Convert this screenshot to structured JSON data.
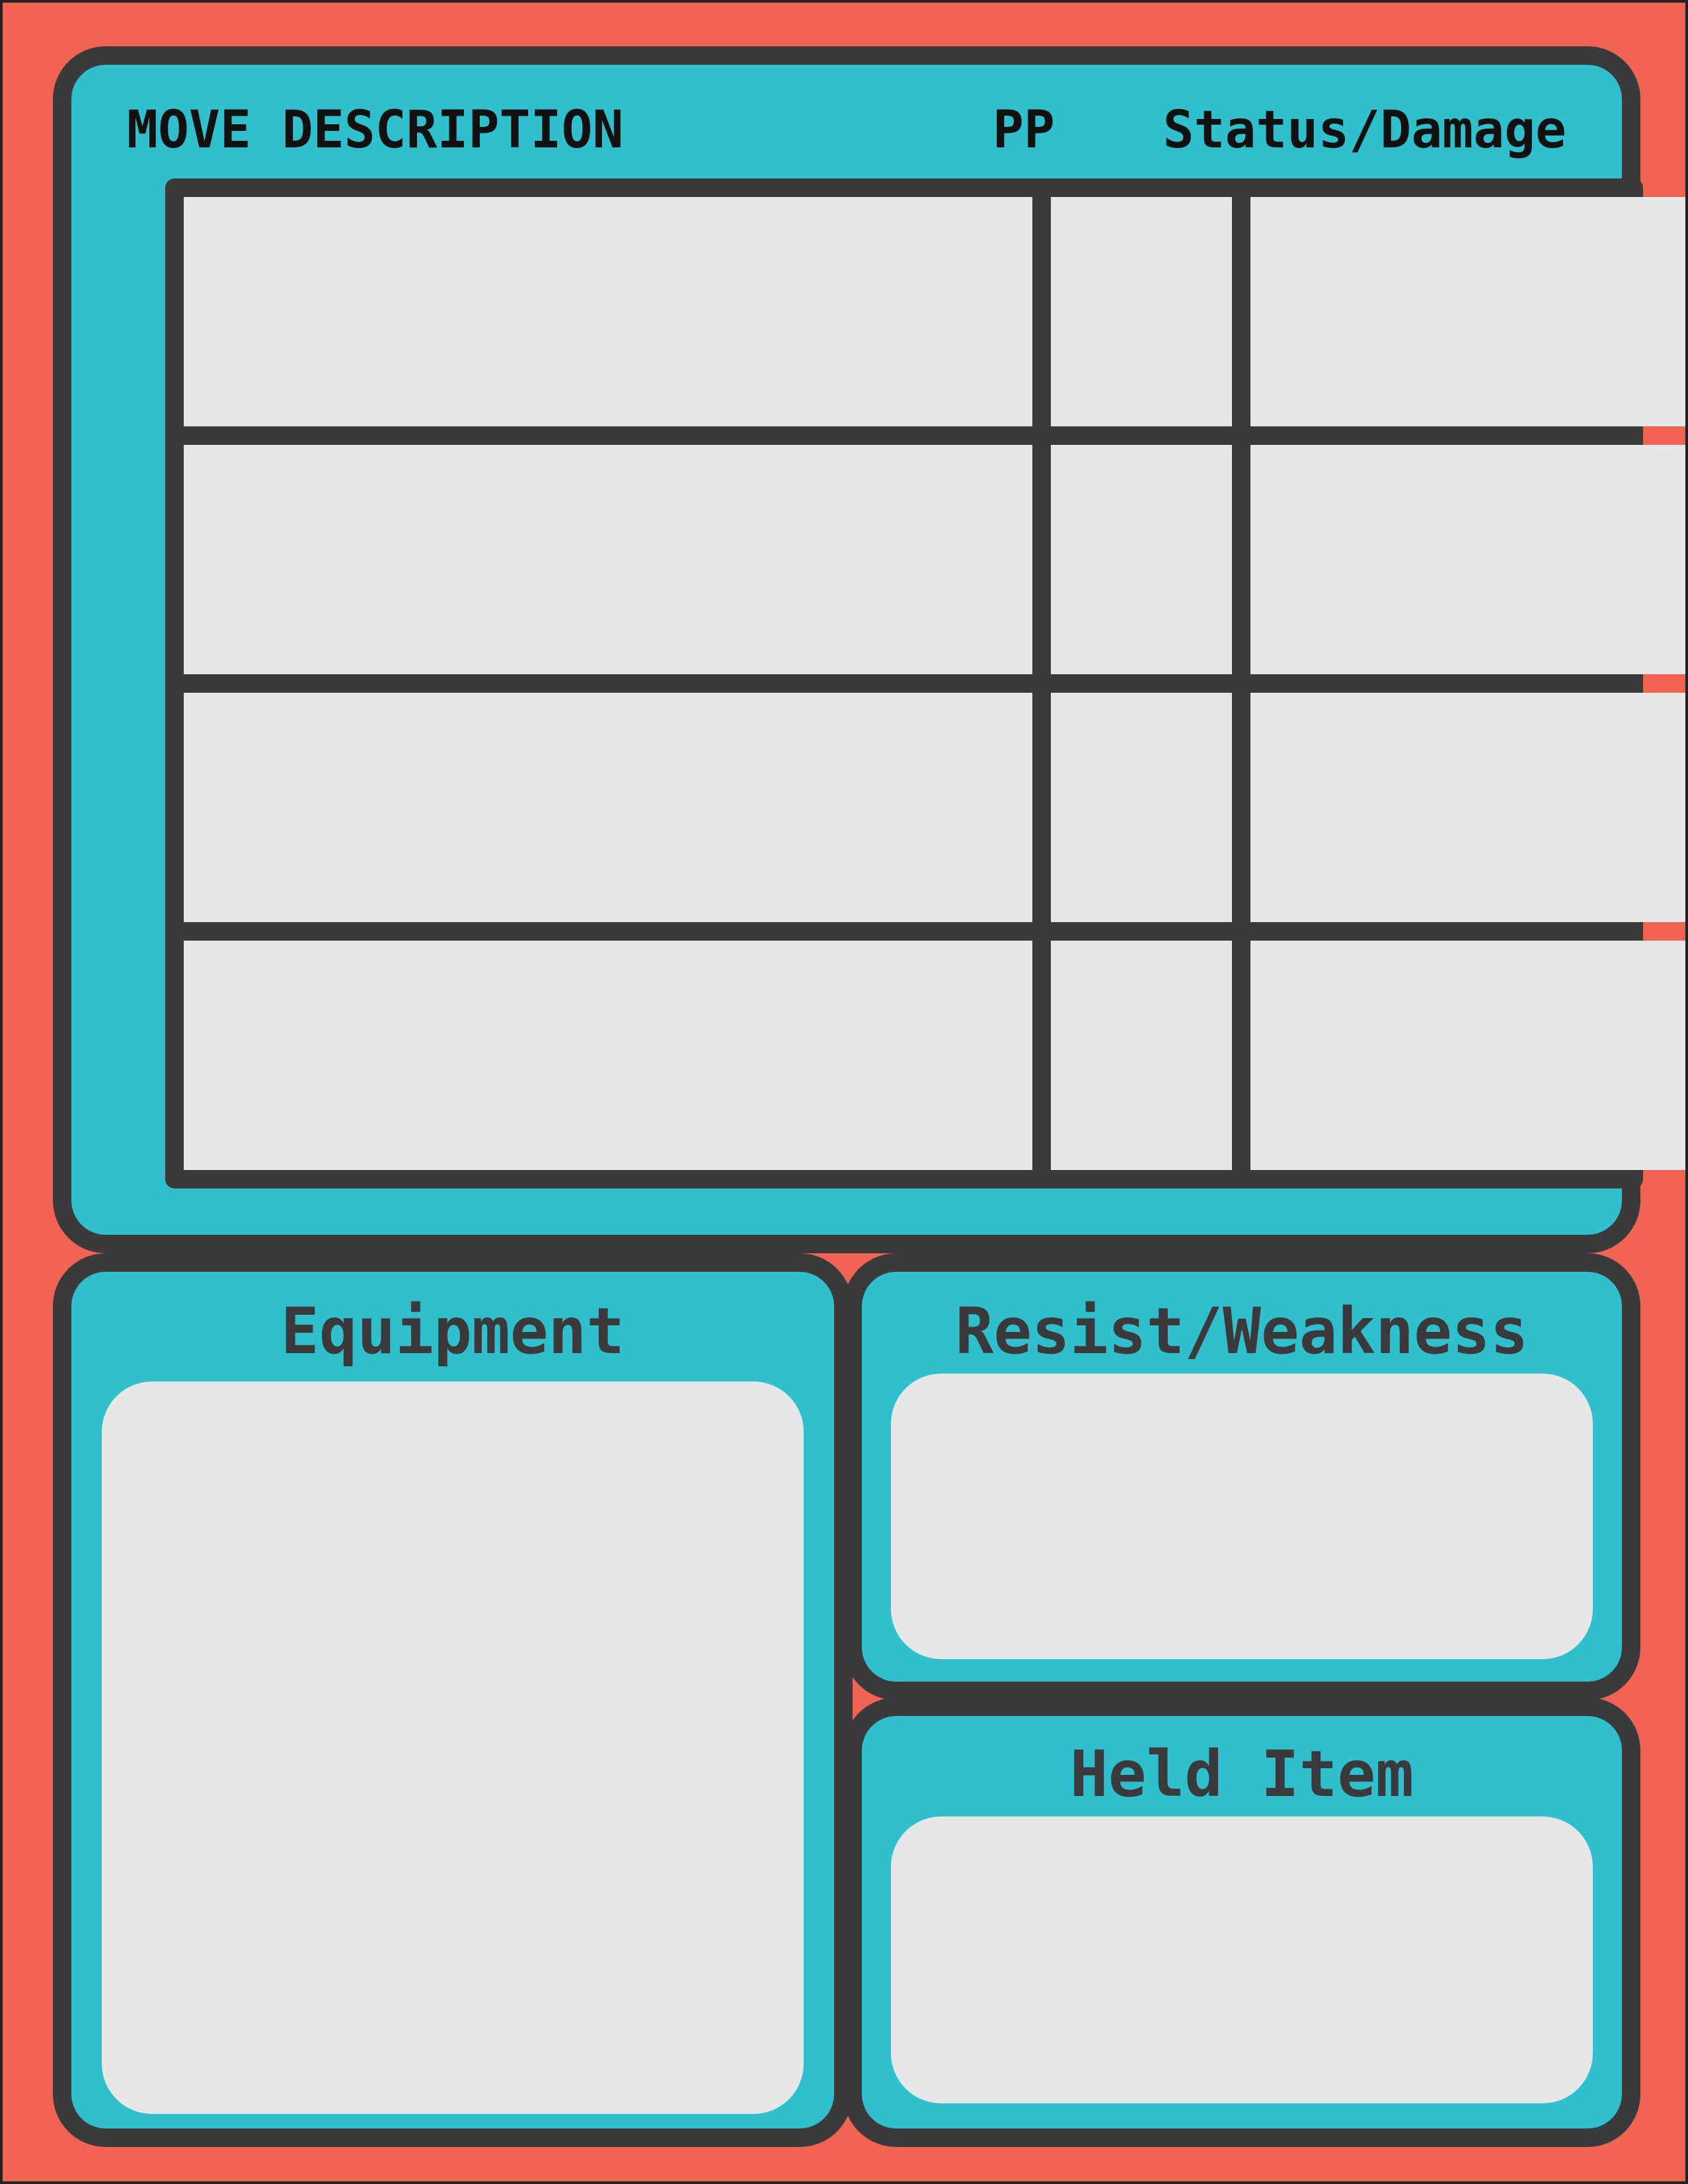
{
  "colors": {
    "background": "#f16353",
    "panel": "#30bfcc",
    "outline": "#3a3a3c",
    "field": "#e6e7e9",
    "header_text": "#111111"
  },
  "moves": {
    "headers": {
      "description": "MOVE DESCRIPTION",
      "pp": "PP",
      "status": "Status/Damage"
    },
    "rows": [
      {
        "description": "",
        "pp": "",
        "status": ""
      },
      {
        "description": "",
        "pp": "",
        "status": ""
      },
      {
        "description": "",
        "pp": "",
        "status": ""
      },
      {
        "description": "",
        "pp": "",
        "status": ""
      }
    ]
  },
  "equipment": {
    "title": "Equipment",
    "value": ""
  },
  "resist_weakness": {
    "title": "Resist/Weakness",
    "value": ""
  },
  "held_item": {
    "title": "Held Item",
    "value": ""
  }
}
